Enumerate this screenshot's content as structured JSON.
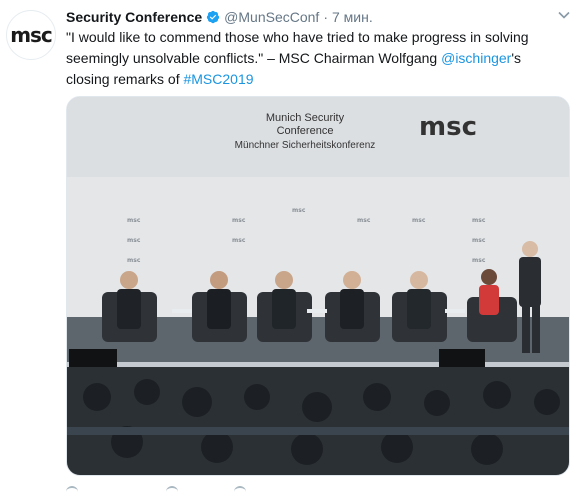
{
  "tweet": {
    "account_name": "Security Conference",
    "handle": "@MunSecConf",
    "separator": "·",
    "time": "7 мин.",
    "avatar_label": "msc",
    "text_part1": "\"I would like to commend those who have tried to make progress in solving seemingly unsolvable conflicts.\" – MSC Chairman Wolfgang ",
    "mention": "@ischinger",
    "text_part2": "'s closing remarks of ",
    "hashtag": "#MSC2019"
  },
  "media": {
    "banner_line1": "Munich Security",
    "banner_line2": "Conference",
    "banner_line3": "Münchner Sicherheitskonferenz",
    "banner_logo": "msc",
    "backdrop_logo": "msc"
  },
  "colors": {
    "link": "#1b95e0",
    "verified": "#1da1f2",
    "secondary_text": "#657786"
  },
  "icons": {
    "verified": "verified-badge-icon",
    "more": "chevron-down-icon"
  }
}
